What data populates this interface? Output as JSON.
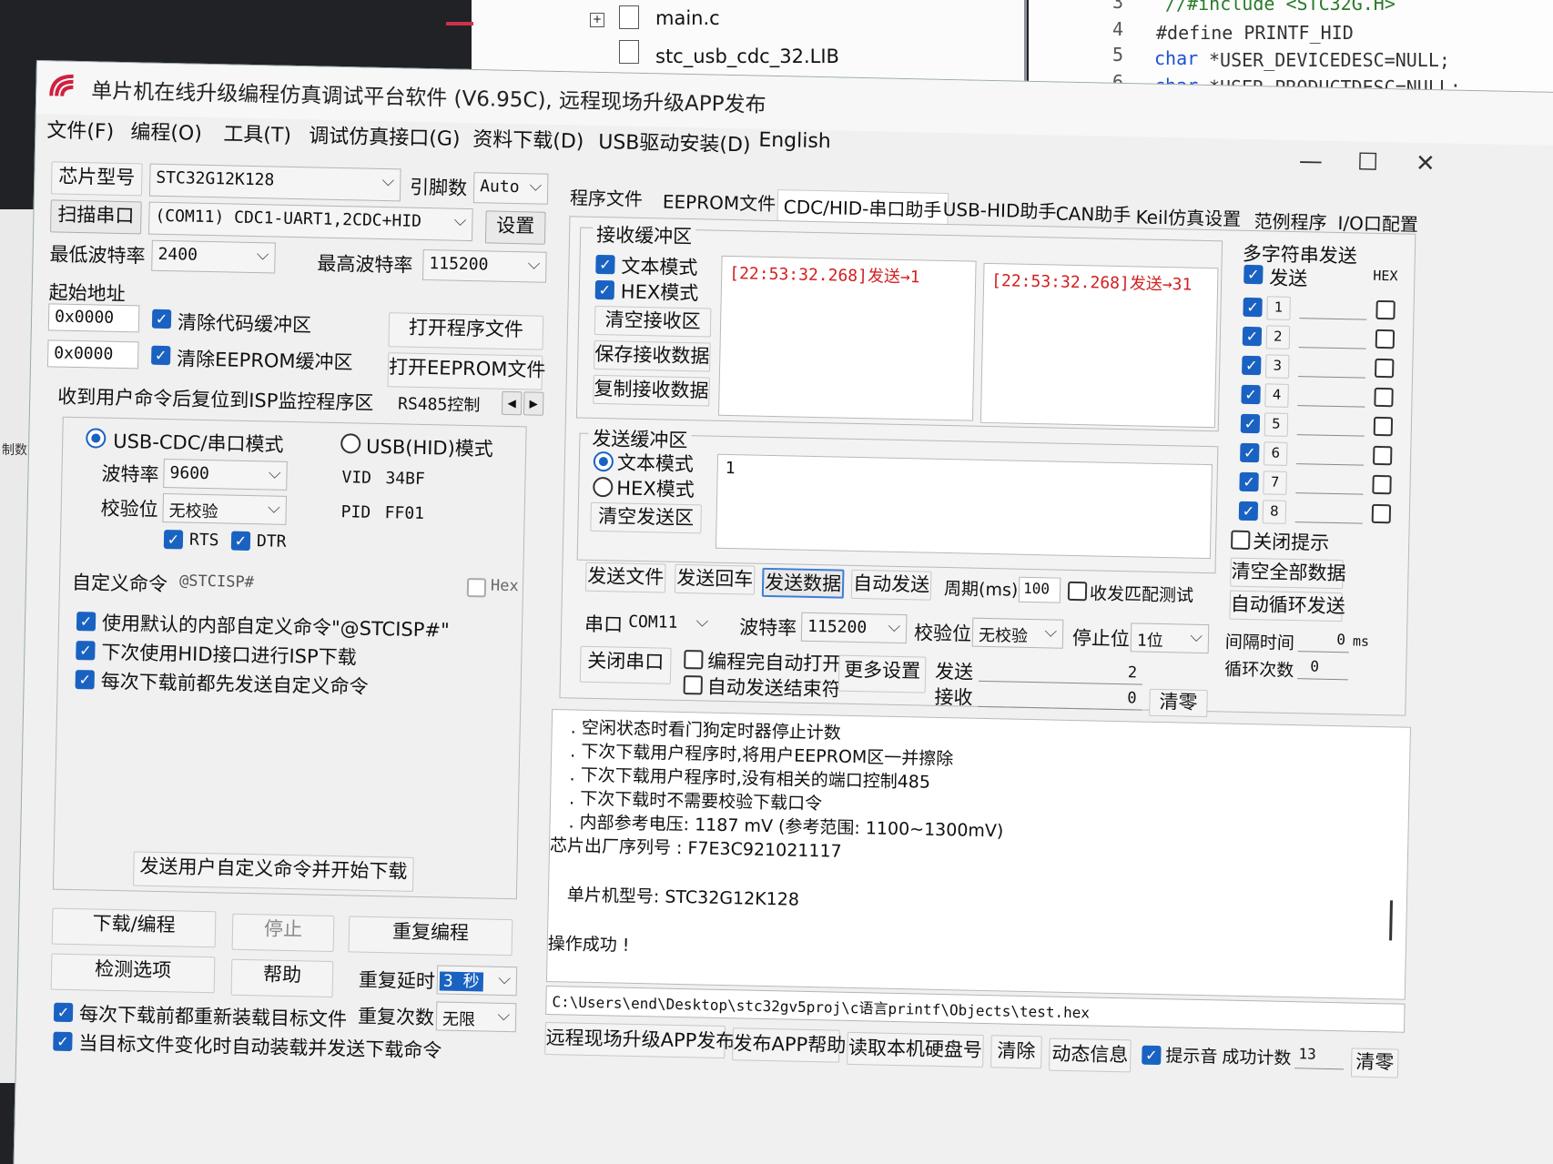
{
  "bg": {
    "tree": {
      "item1": "main.c",
      "item2": "stc_usb_cdc_32.LIB"
    },
    "code": {
      "lines": [
        {
          "num": "3",
          "text": "//#include <STC32G.H>"
        },
        {
          "num": "4",
          "text": "#define PRINTF_HID"
        },
        {
          "num": "5",
          "kw": "char",
          "text": " *USER_DEVICEDESC=NULL;"
        },
        {
          "num": "6",
          "kw": "char",
          "text": " *USER_PRODUCTDESC=NULL;"
        }
      ]
    },
    "left_label": "制数"
  },
  "window": {
    "title": "单片机在线升级编程仿真调试平台软件 (V6.95C), 远程现场升级APP发布",
    "controls": {
      "minimize": "—",
      "maximize": "☐",
      "close": "✕"
    },
    "menu": [
      "文件(F)",
      "编程(O)",
      "工具(T)",
      "调试仿真接口(G)",
      "资料下载(D)",
      "USB驱动安装(D)",
      "English"
    ]
  },
  "left": {
    "chip_label": "芯片型号",
    "chip_value": "STC32G12K128",
    "pins_label": "引脚数",
    "pins_value": "Auto",
    "scan_btn": "扫描串口",
    "port_value": "(COM11) CDC1-UART1,2CDC+HID",
    "settings_btn": "设置",
    "min_baud_label": "最低波特率",
    "min_baud_value": "2400",
    "max_baud_label": "最高波特率",
    "max_baud_value": "115200",
    "start_addr_label": "起始地址",
    "addr1": "0x0000",
    "clear_code": "清除代码缓冲区",
    "open_prog": "打开程序文件",
    "addr2": "0x0000",
    "clear_eeprom": "清除EEPROM缓冲区",
    "open_eeprom": "打开EEPROM文件",
    "reset_label": "收到用户命令后复位到ISP监控程序区",
    "rs485": "RS485控制",
    "mode_cdc": "USB-CDC/串口模式",
    "mode_hid": "USB(HID)模式",
    "baud_label": "波特率",
    "baud_value": "9600",
    "parity_label": "校验位",
    "parity_value": "无校验",
    "rts": "RTS",
    "dtr": "DTR",
    "vid_label": "VID",
    "vid_value": "34BF",
    "pid_label": "PID",
    "pid_value": "FF01",
    "custom_label": "自定义命令",
    "custom_value": "@STCISP#",
    "hex_label": "Hex",
    "opt1": "使用默认的内部自定义命令\"@STCISP#\"",
    "opt2": "下次使用HID接口进行ISP下载",
    "opt3": "每次下载前都先发送自定义命令",
    "send_custom_btn": "发送用户自定义命令并开始下载",
    "download_btn": "下载/编程",
    "stop_btn": "停止",
    "reprog_btn": "重复编程",
    "check_btn": "检测选项",
    "help_btn": "帮助",
    "repeat_delay_label": "重复延时",
    "repeat_delay_value": "3 秒",
    "repeat_count_label": "重复次数",
    "repeat_count_value": "无限",
    "reload_opt": "每次下载前都重新装载目标文件",
    "auto_opt": "当目标文件变化时自动装载并发送下载命令"
  },
  "tabs": [
    "程序文件",
    "EEPROM文件",
    "CDC/HID-串口助手",
    "USB-HID助手",
    "CAN助手",
    "Keil仿真设置",
    "范例程序",
    "I/O口配置"
  ],
  "serial": {
    "recv_group": "接收缓冲区",
    "text_mode": "文本模式",
    "hex_mode": "HEX模式",
    "clear_recv": "清空接收区",
    "save_recv": "保存接收数据",
    "copy_recv": "复制接收数据",
    "recv_text1": "[22:53:32.268]发送→1",
    "recv_text2": "[22:53:32.268]发送→31",
    "send_group": "发送缓冲区",
    "send_text": "1",
    "clear_send": "清空发送区",
    "send_file": "发送文件",
    "send_cr": "发送回车",
    "send_data": "发送数据",
    "auto_send": "自动发送",
    "period_label": "周期(ms)",
    "period_value": "100",
    "match_test": "收发匹配测试",
    "port_label": "串口",
    "port_value": "COM11",
    "baud_label": "波特率",
    "baud_value": "115200",
    "parity_label": "校验位",
    "parity_value": "无校验",
    "stop_label": "停止位",
    "stop_value": "1位",
    "close_port": "关闭串口",
    "auto_open": "编程完自动打开",
    "auto_end": "自动发送结束符",
    "more_settings": "更多设置",
    "send_label": "发送",
    "send_count": "2",
    "recv_label": "接收",
    "recv_count": "0",
    "zero_btn": "清零",
    "multi_group": "多字符串发送",
    "multi_send": "发送",
    "multi_hex": "HEX",
    "multi_items": [
      "1",
      "2",
      "3",
      "4",
      "5",
      "6",
      "7",
      "8"
    ],
    "close_tip": "关闭提示",
    "clear_all": "清空全部数据",
    "auto_cycle": "自动循环发送",
    "interval_label": "间隔时间",
    "interval_value": "0",
    "interval_unit": "ms",
    "cycles_label": "循环次数",
    "cycles_value": "0"
  },
  "log": {
    "lines": [
      ". 空闲状态时看门狗定时器停止计数",
      ". 下次下载用户程序时,将用户EEPROM区一并擦除",
      ". 下次下载用户程序时,没有相关的端口控制485",
      ". 下次下载时不需要校验下载口令",
      ". 内部参考电压: 1187 mV (参考范围: 1100~1300mV)",
      "芯片出厂序列号 : F7E3C921021117",
      "单片机型号: STC32G12K128",
      "操作成功 !"
    ],
    "path": "C:\\Users\\end\\Desktop\\stc32gv5proj\\c语言printf\\Objects\\test.hex"
  },
  "bottom": {
    "remote_btn": "远程现场升级APP发布",
    "app_help_btn": "发布APP帮助",
    "read_disk_btn": "读取本机硬盘号",
    "clear_btn": "清除",
    "dyn_info_btn": "动态信息",
    "beep_label": "提示音",
    "success_label": "成功计数",
    "success_value": "13",
    "zero_btn": "清零"
  }
}
